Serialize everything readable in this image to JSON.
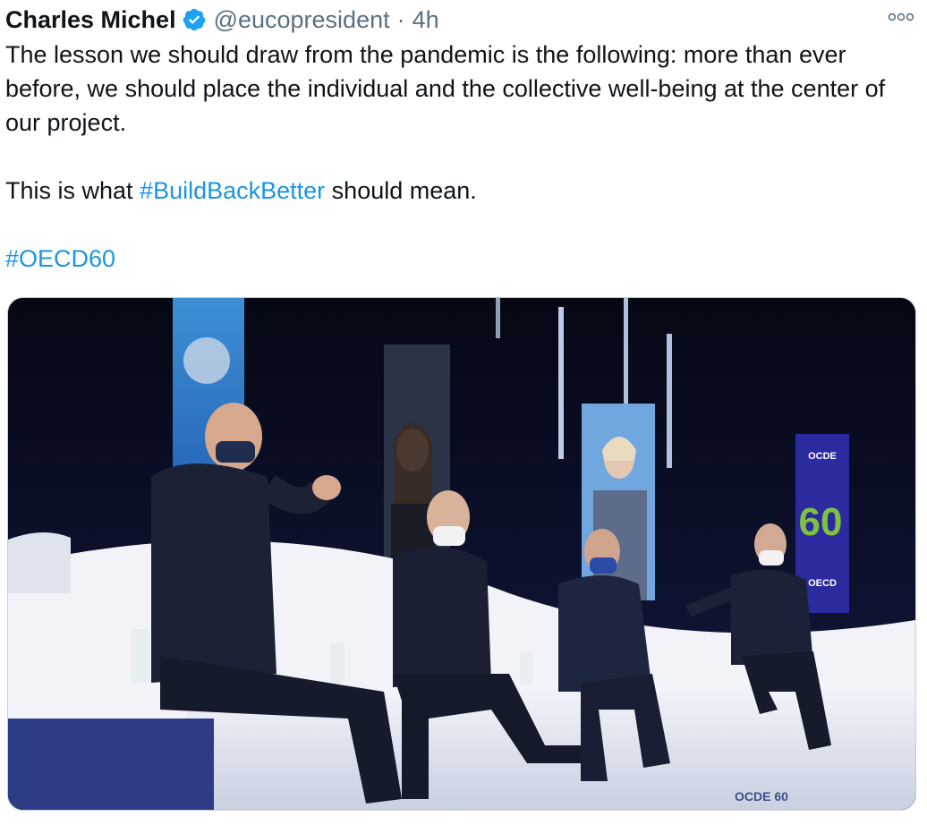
{
  "tweet": {
    "author_name": "Charles Michel",
    "handle": "@eucopresident",
    "separator": "·",
    "time": "4h",
    "text_line1": "The lesson we should draw from the pandemic is the following: more than ever before, we should place the individual and the collective well-being at the center of our project.",
    "text_pre": "This is what ",
    "hashtag1": "#BuildBackBetter",
    "text_post": " should mean.",
    "hashtag2": "#OECD60"
  },
  "media": {
    "banner_right_top": "OCDE",
    "banner_right_number": "60",
    "banner_right_bottom": "OECD",
    "stage_logo": "OCDE 60"
  },
  "colors": {
    "link": "#1b95e0",
    "secondary_text": "#5b7083",
    "verified_badge": "#1da1f2",
    "oecd_banner": "#2b2a9e",
    "oecd_green": "#7fc241"
  },
  "icons": {
    "verified": "verified-badge-icon",
    "more": "more-options-icon"
  }
}
